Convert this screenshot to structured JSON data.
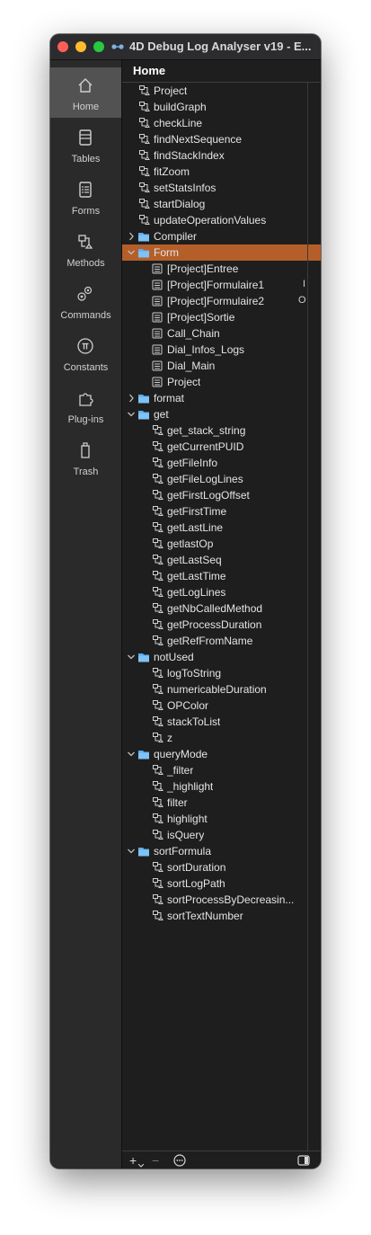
{
  "window": {
    "title": "4D Debug Log Analyser v19 - E..."
  },
  "sidebar": {
    "items": [
      {
        "label": "Home",
        "icon": "home-icon",
        "active": true
      },
      {
        "label": "Tables",
        "icon": "tables-icon"
      },
      {
        "label": "Forms",
        "icon": "forms-icon"
      },
      {
        "label": "Methods",
        "icon": "methods-icon"
      },
      {
        "label": "Commands",
        "icon": "commands-icon"
      },
      {
        "label": "Constants",
        "icon": "constants-icon"
      },
      {
        "label": "Plug-ins",
        "icon": "plugins-icon"
      },
      {
        "label": "Trash",
        "icon": "trash-icon"
      }
    ]
  },
  "header": {
    "title": "Home"
  },
  "tree": {
    "rows": [
      {
        "label": "Project",
        "icon": "method-icon",
        "level": 1
      },
      {
        "label": "buildGraph",
        "icon": "method-icon",
        "level": 1
      },
      {
        "label": "checkLine",
        "icon": "method-icon",
        "level": 1
      },
      {
        "label": "findNextSequence",
        "icon": "method-icon",
        "level": 1
      },
      {
        "label": "findStackIndex",
        "icon": "method-icon",
        "level": 1
      },
      {
        "label": "fitZoom",
        "icon": "method-icon",
        "level": 1
      },
      {
        "label": "setStatsInfos",
        "icon": "method-icon",
        "level": 1
      },
      {
        "label": "startDialog",
        "icon": "method-icon",
        "level": 1
      },
      {
        "label": "updateOperationValues",
        "icon": "method-icon",
        "level": 1
      },
      {
        "label": "Compiler",
        "icon": "folder-icon",
        "level": 0,
        "expanded": false
      },
      {
        "label": "Form",
        "icon": "folder-icon",
        "level": 0,
        "expanded": true,
        "selected": true
      },
      {
        "label": "[Project]Entree",
        "icon": "form-icon",
        "level": 2
      },
      {
        "label": "[Project]Formulaire1",
        "icon": "form-icon",
        "level": 2,
        "extra": "I"
      },
      {
        "label": "[Project]Formulaire2",
        "icon": "form-icon",
        "level": 2,
        "extra": "O"
      },
      {
        "label": "[Project]Sortie",
        "icon": "form-icon",
        "level": 2
      },
      {
        "label": "Call_Chain",
        "icon": "form-icon",
        "level": 2
      },
      {
        "label": "Dial_Infos_Logs",
        "icon": "form-icon",
        "level": 2
      },
      {
        "label": "Dial_Main",
        "icon": "form-icon",
        "level": 2
      },
      {
        "label": "Project",
        "icon": "form-icon",
        "level": 2
      },
      {
        "label": "format",
        "icon": "folder-icon",
        "level": 0,
        "expanded": false
      },
      {
        "label": "get",
        "icon": "folder-icon",
        "level": 0,
        "expanded": true
      },
      {
        "label": "get_stack_string",
        "icon": "method-icon",
        "level": 2
      },
      {
        "label": "getCurrentPUID",
        "icon": "method-icon",
        "level": 2
      },
      {
        "label": "getFileInfo",
        "icon": "method-icon",
        "level": 2
      },
      {
        "label": "getFileLogLines",
        "icon": "method-icon",
        "level": 2
      },
      {
        "label": "getFirstLogOffset",
        "icon": "method-icon",
        "level": 2
      },
      {
        "label": "getFirstTime",
        "icon": "method-icon",
        "level": 2
      },
      {
        "label": "getLastLine",
        "icon": "method-icon",
        "level": 2
      },
      {
        "label": "getlastOp",
        "icon": "method-icon",
        "level": 2
      },
      {
        "label": "getLastSeq",
        "icon": "method-icon",
        "level": 2
      },
      {
        "label": "getLastTime",
        "icon": "method-icon",
        "level": 2
      },
      {
        "label": "getLogLines",
        "icon": "method-icon",
        "level": 2
      },
      {
        "label": "getNbCalledMethod",
        "icon": "method-icon",
        "level": 2
      },
      {
        "label": "getProcessDuration",
        "icon": "method-icon",
        "level": 2
      },
      {
        "label": "getRefFromName",
        "icon": "method-icon",
        "level": 2
      },
      {
        "label": "notUsed",
        "icon": "folder-icon",
        "level": 0,
        "expanded": true
      },
      {
        "label": "logToString",
        "icon": "method-icon",
        "level": 2
      },
      {
        "label": "numericableDuration",
        "icon": "method-icon",
        "level": 2
      },
      {
        "label": "OPColor",
        "icon": "method-icon",
        "level": 2
      },
      {
        "label": "stackToList",
        "icon": "method-icon",
        "level": 2
      },
      {
        "label": "z",
        "icon": "method-icon",
        "level": 2
      },
      {
        "label": "queryMode",
        "icon": "folder-icon",
        "level": 0,
        "expanded": true
      },
      {
        "label": "_filter",
        "icon": "method-icon",
        "level": 2
      },
      {
        "label": "_highlight",
        "icon": "method-icon",
        "level": 2
      },
      {
        "label": "filter",
        "icon": "method-icon",
        "level": 2
      },
      {
        "label": "highlight",
        "icon": "method-icon",
        "level": 2
      },
      {
        "label": "isQuery",
        "icon": "method-icon",
        "level": 2
      },
      {
        "label": "sortFormula",
        "icon": "folder-icon",
        "level": 0,
        "expanded": true
      },
      {
        "label": "sortDuration",
        "icon": "method-icon",
        "level": 2
      },
      {
        "label": "sortLogPath",
        "icon": "method-icon",
        "level": 2
      },
      {
        "label": "sortProcessByDecreasin...",
        "icon": "method-icon",
        "level": 2
      },
      {
        "label": "sortTextNumber",
        "icon": "method-icon",
        "level": 2
      }
    ]
  },
  "bottombar": {
    "add_label": "+",
    "remove_label": "−",
    "more_label": "⋯"
  },
  "colors": {
    "selection": "#b45f2a",
    "folder": "#5aaef0",
    "active_nav": "#525252"
  }
}
